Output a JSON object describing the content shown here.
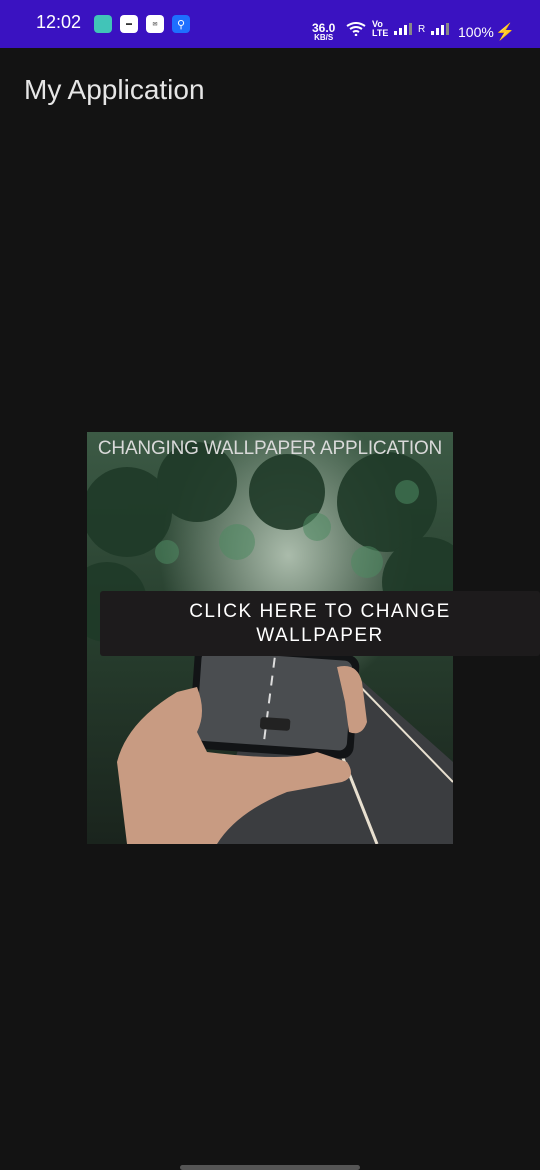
{
  "status_bar": {
    "time": "12:02",
    "net_speed_value": "36.0",
    "net_speed_unit": "KB/S",
    "volte_label": "Vo LTE",
    "roaming_label": "R",
    "battery": "100%",
    "bolt_icon": "⚡",
    "app_icons": [
      "messages-icon",
      "dialer-icon",
      "mail-icon",
      "usb-icon"
    ]
  },
  "app_bar": {
    "title": "My Application"
  },
  "wallpaper_card": {
    "caption": "CHANGING WALLPAPER APPLICATION",
    "image": "forest road with hand holding phone"
  },
  "change_button": {
    "label": "CLICK HERE TO CHANGE WALLPAPER"
  },
  "colors": {
    "status_bar": "#3a12c1",
    "background": "#131313",
    "button_bg": "#1d1b1c"
  }
}
